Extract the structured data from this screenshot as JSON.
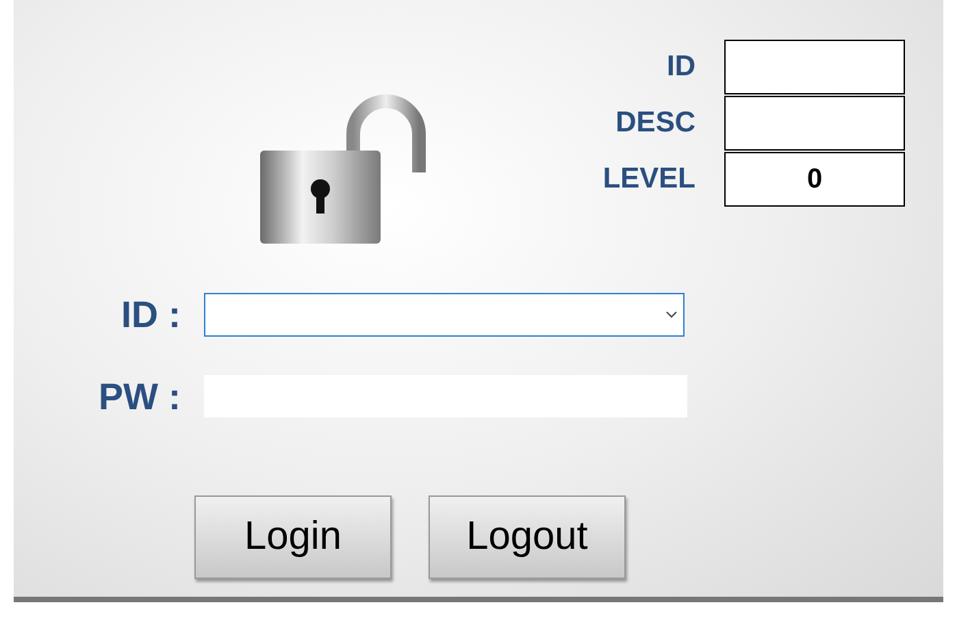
{
  "info_fields": [
    {
      "label": "ID"
    },
    {
      "label": "DESC"
    },
    {
      "label": "LEVEL",
      "value": "0"
    }
  ],
  "form": [
    {
      "label": "ID :",
      "kind": "dropdown"
    },
    {
      "label": "PW :",
      "kind": "password"
    }
  ],
  "buttons": [
    "Login",
    "Logout"
  ]
}
